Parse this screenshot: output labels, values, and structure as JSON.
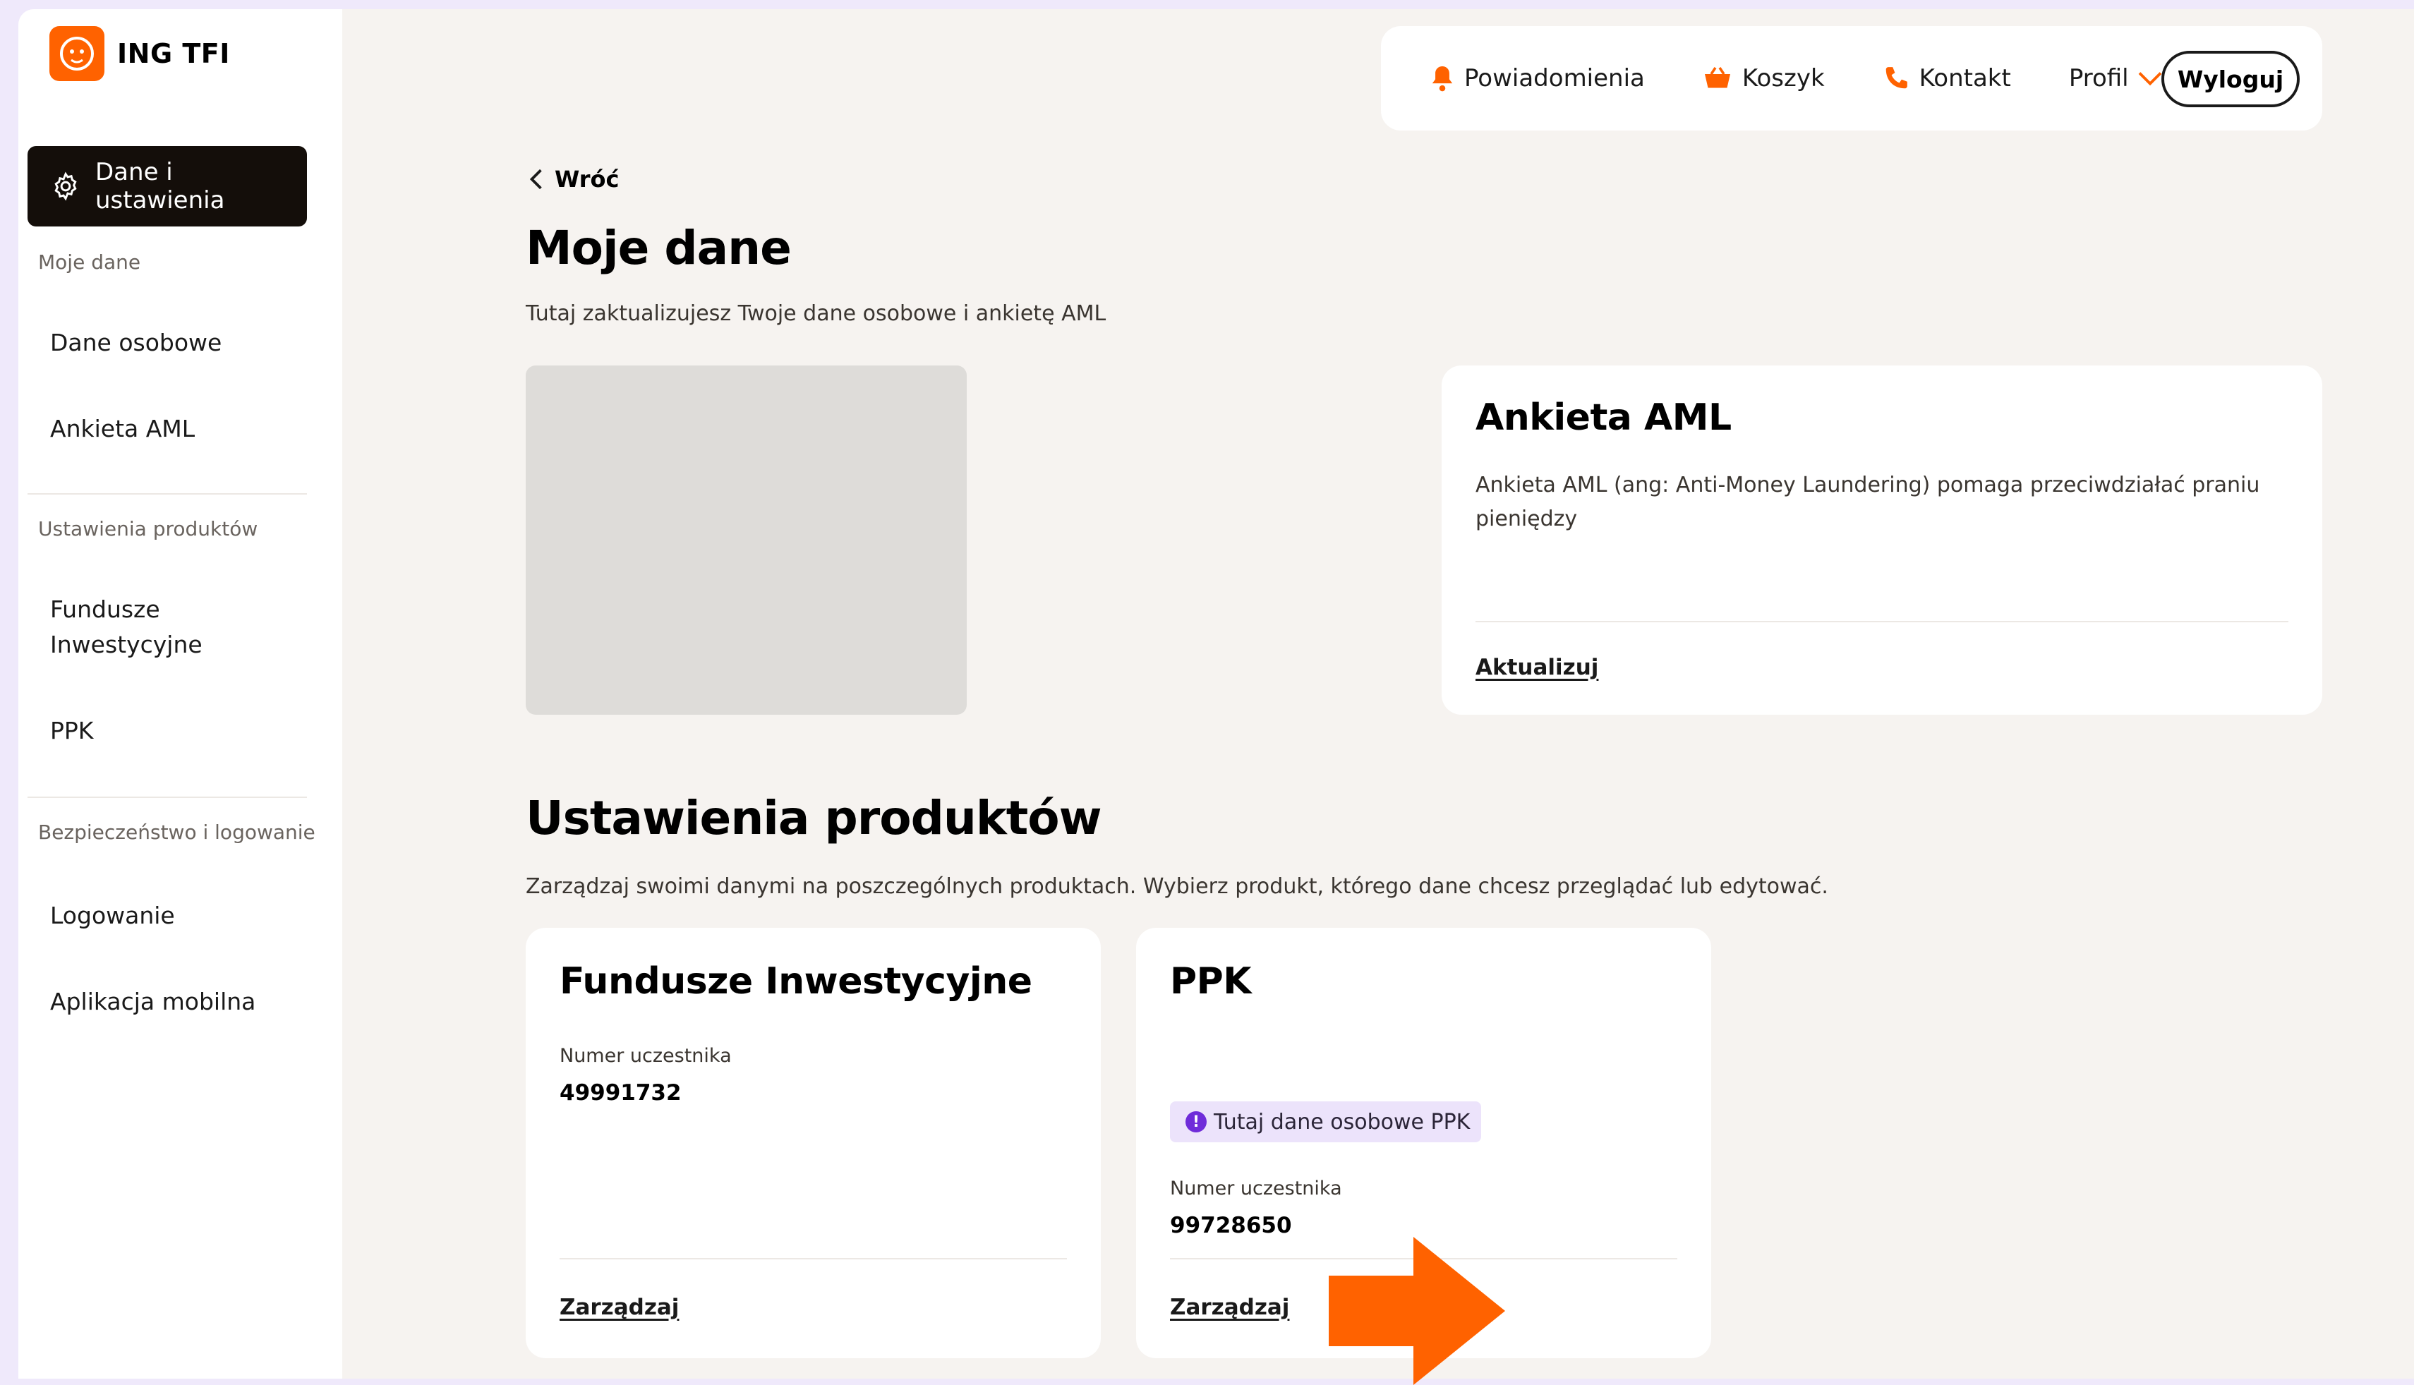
{
  "app": {
    "logo_text": "ING TFI"
  },
  "colors": {
    "accent": "#ff6200",
    "dark": "#140e0a",
    "badge_bg": "#ece3fb",
    "badge_dot": "#6f2cd9"
  },
  "sidebar": {
    "active_item": "Dane i ustawienia",
    "sections": [
      {
        "title": "Moje dane",
        "items": [
          "Dane osobowe",
          "Ankieta AML"
        ]
      },
      {
        "title": "Ustawienia produktów",
        "items": [
          "Fundusze Inwestycyjne",
          "PPK"
        ]
      },
      {
        "title": "Bezpieczeństwo i logowanie",
        "items": [
          "Logowanie",
          "Aplikacja mobilna"
        ]
      }
    ]
  },
  "topbar": {
    "notifications": "Powiadomienia",
    "cart": "Koszyk",
    "contact": "Kontakt",
    "profile": "Profil",
    "logout": "Wyloguj"
  },
  "page": {
    "back": "Wróć",
    "title": "Moje dane",
    "subtitle": "Tutaj zaktualizujesz Twoje dane osobowe i ankietę AML"
  },
  "aml_card": {
    "title": "Ankieta AML",
    "text": "Ankieta AML (ang: Anti-Money Laundering) pomaga przeciwdziałać praniu pieniędzy",
    "link": "Aktualizuj"
  },
  "products": {
    "title": "Ustawienia produktów",
    "subtitle": "Zarządzaj swoimi danymi na poszczególnych produktach. Wybierz produkt, którego dane chcesz przeglądać lub edytować.",
    "cards": [
      {
        "title": "Fundusze Inwestycyjne",
        "label": "Numer uczestnika",
        "number": "49991732",
        "link": "Zarządzaj"
      },
      {
        "title": "PPK",
        "badge": "Tutaj dane osobowe PPK",
        "label": "Numer uczestnika",
        "number": "99728650",
        "link": "Zarządzaj"
      }
    ]
  }
}
